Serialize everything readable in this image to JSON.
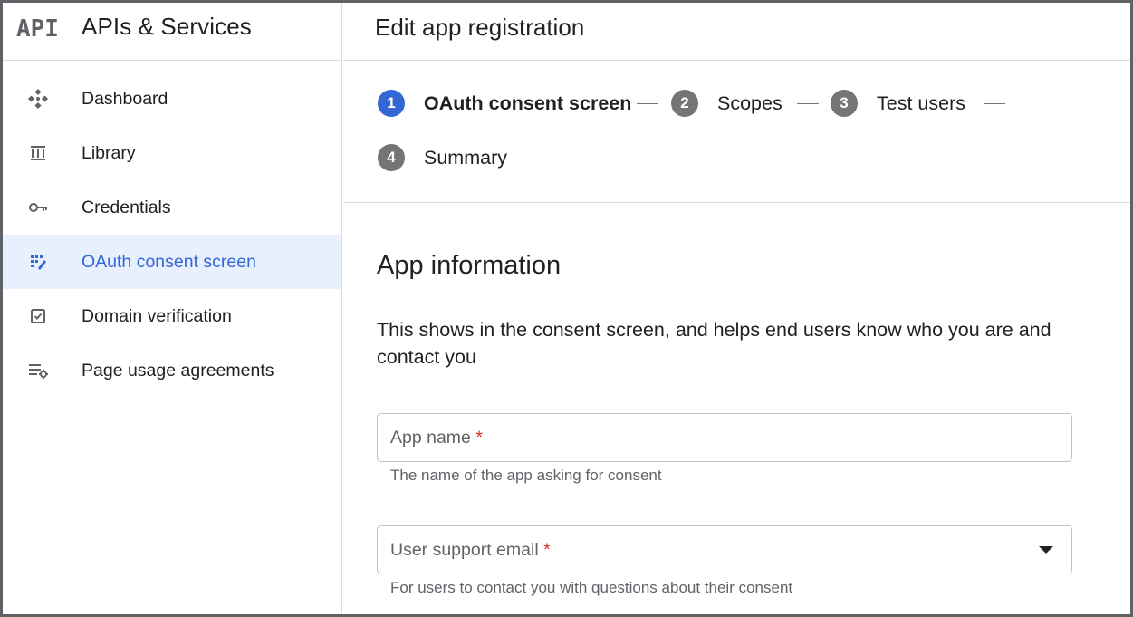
{
  "sidebar": {
    "logo_text": "API",
    "title": "APIs & Services",
    "items": [
      {
        "label": "Dashboard",
        "icon": "dashboard-icon"
      },
      {
        "label": "Library",
        "icon": "library-icon"
      },
      {
        "label": "Credentials",
        "icon": "key-icon"
      },
      {
        "label": "OAuth consent screen",
        "icon": "consent-icon",
        "active": true
      },
      {
        "label": "Domain verification",
        "icon": "checkbox-icon"
      },
      {
        "label": "Page usage agreements",
        "icon": "settings-list-icon"
      }
    ]
  },
  "header": {
    "title": "Edit app registration"
  },
  "stepper": {
    "steps": [
      {
        "num": "1",
        "label": "OAuth consent screen",
        "current": true
      },
      {
        "num": "2",
        "label": "Scopes"
      },
      {
        "num": "3",
        "label": "Test users"
      },
      {
        "num": "4",
        "label": "Summary"
      }
    ]
  },
  "form": {
    "section_title": "App information",
    "section_desc": "This shows in the consent screen, and helps end users know who you are and contact you",
    "app_name": {
      "label": "App name",
      "required_mark": "*",
      "hint": "The name of the app asking for consent",
      "value": ""
    },
    "support_email": {
      "label": "User support email",
      "required_mark": "*",
      "hint": "For users to contact you with questions about their consent",
      "value": ""
    }
  },
  "colors": {
    "accent": "#3367d6",
    "active_bg": "#e8f0fe",
    "required": "#d93025",
    "step_inactive": "#757575",
    "border": "#dadce0"
  }
}
